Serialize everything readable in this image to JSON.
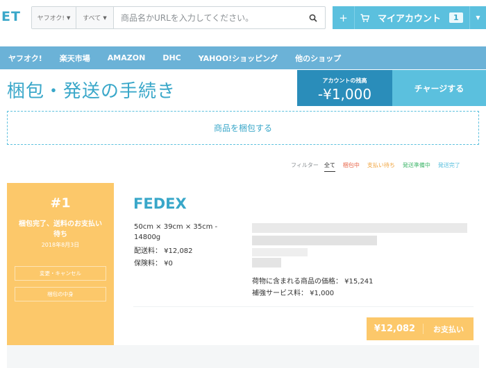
{
  "header": {
    "logo": "ET",
    "search": {
      "site_select": "ヤフオク!",
      "category_select": "すべて",
      "placeholder": "商品名かURLを入力してください。"
    },
    "account": {
      "plus": "+",
      "label": "マイアカウント",
      "badge": "1"
    }
  },
  "nav": {
    "items": [
      "ヤフオク!",
      "楽天市場",
      "AMAZON",
      "DHC",
      "YAHOO!ショッピング",
      "他のショップ"
    ]
  },
  "page": {
    "title": "梱包・発送の手続き",
    "balance_label": "アカウントの残高",
    "balance_amount": "-¥1,000",
    "charge_button": "チャージする",
    "pack_button": "商品を梱包する"
  },
  "filters": {
    "label": "フィルター",
    "items": [
      "全て",
      "梱包中",
      "支払い待ち",
      "発送準備中",
      "発送完了"
    ],
    "active": "全て"
  },
  "order": {
    "number": "#1",
    "status": "梱包完了、送料のお支払い待ち",
    "date": "2018年8月3日",
    "change_cancel": "変更・キャンセル",
    "contents": "梱包の中身",
    "carrier": "FEDEX",
    "dimensions": "50cm × 39cm × 35cm - 14800g",
    "shipping_fee": "配送料： ¥12,082",
    "insurance_fee": "保険料： ¥0",
    "item_price": "荷物に含まれる商品の価格： ¥15,241",
    "reinforcement_fee": "補強サービス料： ¥1,000",
    "pay_amount": "¥12,082",
    "pay_label": "お支払い"
  },
  "colors": {
    "primary": "#5bc0de",
    "primary_dark": "#2a8dba",
    "nav": "#6bb2d7",
    "order_accent": "#fcc86a"
  }
}
